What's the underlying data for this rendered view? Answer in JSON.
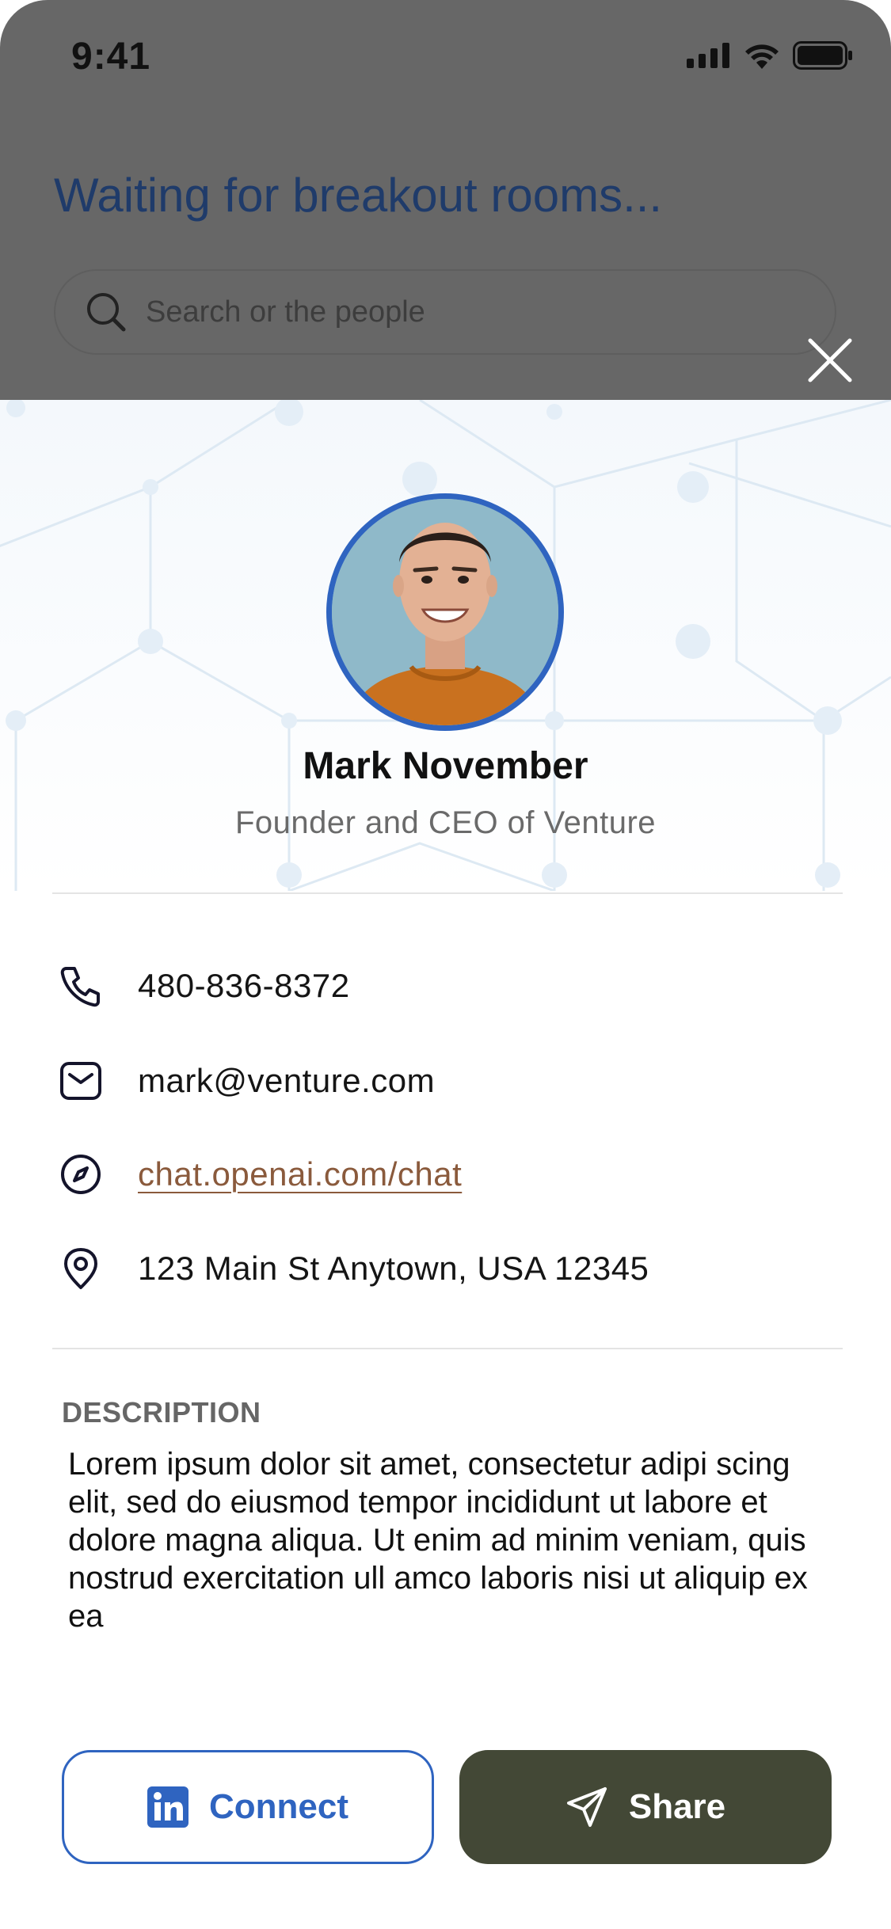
{
  "status_bar": {
    "time": "9:41"
  },
  "background_screen": {
    "title": "Waiting for breakout rooms...",
    "search_placeholder": "Search or the people"
  },
  "profile": {
    "name": "Mark November",
    "role": "Founder and CEO of Venture"
  },
  "contacts": [
    {
      "icon": "phone-icon",
      "text": "480-836-8372"
    },
    {
      "icon": "mail-icon",
      "text": "mark@venture.com"
    },
    {
      "icon": "compass-icon",
      "text": "chat.openai.com/chat"
    },
    {
      "icon": "location-pin-icon",
      "text": "123 Main St Anytown, USA 12345"
    }
  ],
  "description": {
    "label": "DESCRIPTION",
    "text": "Lorem ipsum dolor sit amet, consectetur adipi scing elit, sed do eiusmod tempor incididunt ut labore et dolore magna aliqua. Ut enim ad minim veniam, quis nostrud exercitation ull amco laboris nisi ut aliquip ex ea"
  },
  "actions": {
    "connect_label": "Connect",
    "share_label": "Share"
  },
  "colors": {
    "accent_blue": "#2f64c0",
    "share_bg": "#434836",
    "link": "#8a5a3c",
    "overlay": "#676767"
  }
}
